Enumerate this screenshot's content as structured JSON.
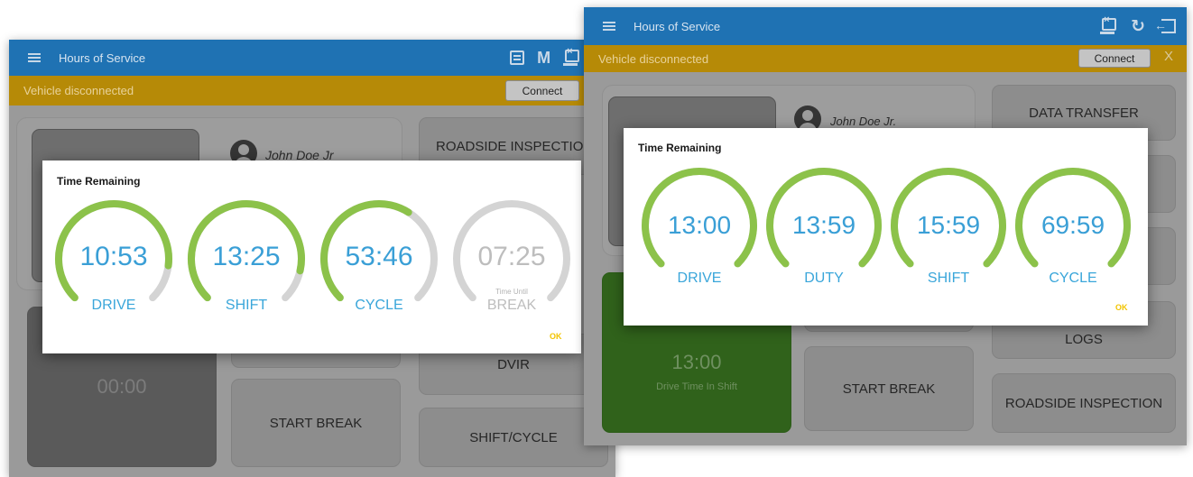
{
  "colors": {
    "app_bar": "#1f72b3",
    "status_bar": "#b68a07",
    "gauge_green": "#8cc24a",
    "gauge_track": "#d4d4d4",
    "gauge_text": "#3a9fd6",
    "ok_text": "#f2c400"
  },
  "left": {
    "app_title": "Hours of Service",
    "toolbar_icons": [
      "message-icon",
      "m-icon",
      "download-icon",
      "refresh-icon"
    ],
    "toolbar_m": "M",
    "status_text": "Vehicle disconnected",
    "connect_label": "Connect",
    "driver_name": "John Doe Jr",
    "tiles": {
      "roadside": "ROADSIDE INSPECTION",
      "dvir": "DVIR",
      "start_break": "START BREAK",
      "shift_cycle": "SHIFT/CYCLE",
      "timer": "00:00"
    },
    "dialog": {
      "title": "Time Remaining",
      "ok_label": "OK",
      "gauges": [
        {
          "value": "10:53",
          "label": "DRIVE",
          "fraction": 0.86,
          "muted": false,
          "sublabel": ""
        },
        {
          "value": "13:25",
          "label": "SHIFT",
          "fraction": 0.88,
          "muted": false,
          "sublabel": ""
        },
        {
          "value": "53:46",
          "label": "CYCLE",
          "fraction": 0.62,
          "muted": false,
          "sublabel": ""
        },
        {
          "value": "07:25",
          "label": "BREAK",
          "fraction": 0.0,
          "muted": true,
          "sublabel": "Time Until"
        }
      ]
    }
  },
  "right": {
    "app_title": "Hours of Service",
    "toolbar_icons": [
      "download-icon",
      "refresh-icon",
      "exit-icon"
    ],
    "status_text": "Vehicle disconnected",
    "connect_label": "Connect",
    "close_x": "X",
    "driver_name": "John Doe Jr.",
    "tiles": {
      "data_transfer": "DATA TRANSFER",
      "logs": "LOGS",
      "start_break": "START BREAK",
      "roadside": "ROADSIDE INSPECTION",
      "drive_time_value": "13:00",
      "drive_time_label": "Drive Time In Shift"
    },
    "dialog": {
      "title": "Time Remaining",
      "ok_label": "OK",
      "gauges": [
        {
          "value": "13:00",
          "label": "DRIVE",
          "fraction": 1.0,
          "muted": false
        },
        {
          "value": "13:59",
          "label": "DUTY",
          "fraction": 1.0,
          "muted": false
        },
        {
          "value": "15:59",
          "label": "SHIFT",
          "fraction": 1.0,
          "muted": false
        },
        {
          "value": "69:59",
          "label": "CYCLE",
          "fraction": 1.0,
          "muted": false
        }
      ]
    }
  }
}
